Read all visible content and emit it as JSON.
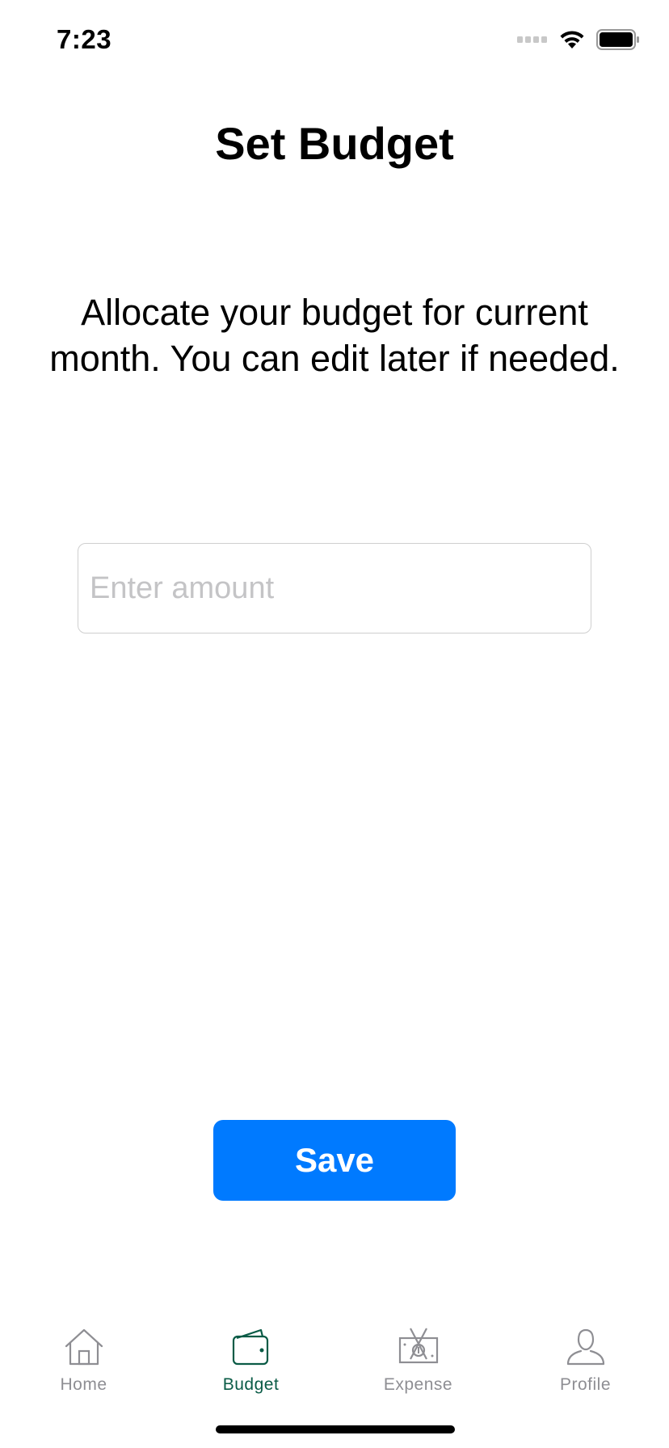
{
  "status_bar": {
    "time": "7:23"
  },
  "page": {
    "title": "Set Budget",
    "description": "Allocate your budget for current month. You can edit later if needed."
  },
  "amount_input": {
    "placeholder": "Enter amount",
    "value": ""
  },
  "actions": {
    "save_label": "Save",
    "save_color": "#007aff"
  },
  "tab_bar": {
    "active_color": "#0a5b46",
    "inactive_color": "#8e8e93",
    "tabs": [
      {
        "label": "Home",
        "icon": "home-icon",
        "active": false
      },
      {
        "label": "Budget",
        "icon": "wallet-icon",
        "active": true
      },
      {
        "label": "Expense",
        "icon": "expense-icon",
        "active": false
      },
      {
        "label": "Profile",
        "icon": "profile-icon",
        "active": false
      }
    ]
  }
}
